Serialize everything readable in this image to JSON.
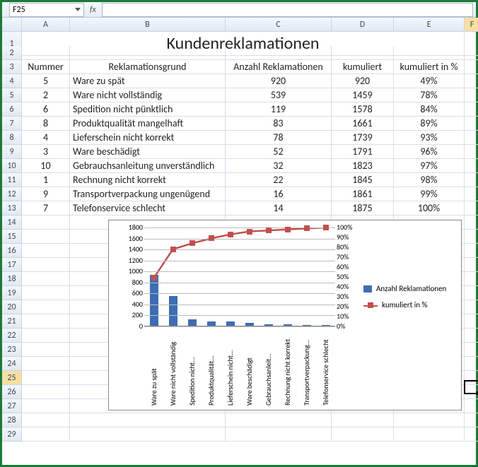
{
  "formula_bar": {
    "cell_ref": "F25",
    "fx_label": "fx",
    "formula": ""
  },
  "columns": [
    "A",
    "B",
    "C",
    "D",
    "E"
  ],
  "row_numbers": [
    1,
    2,
    3,
    4,
    5,
    6,
    7,
    8,
    9,
    10,
    11,
    12,
    13,
    14,
    15,
    16,
    17,
    18,
    19,
    20,
    21,
    22,
    23,
    24,
    25,
    26,
    27,
    28,
    29
  ],
  "title": "Kundenreklamationen",
  "headers": {
    "a": "Nummer",
    "b": "Reklamationsgrund",
    "c": "Anzahl Reklamationen",
    "d": "kumuliert",
    "e": "kumuliert in %"
  },
  "rows": [
    {
      "num": "5",
      "reason": "Ware zu spät",
      "count": "920",
      "cum": "920",
      "pct": "49%"
    },
    {
      "num": "2",
      "reason": "Ware nicht vollständig",
      "count": "539",
      "cum": "1459",
      "pct": "78%"
    },
    {
      "num": "6",
      "reason": "Spedition nicht pünktlich",
      "count": "119",
      "cum": "1578",
      "pct": "84%"
    },
    {
      "num": "8",
      "reason": "Produktqualität mangelhaft",
      "count": "83",
      "cum": "1661",
      "pct": "89%"
    },
    {
      "num": "4",
      "reason": "Lieferschein nicht korrekt",
      "count": "78",
      "cum": "1739",
      "pct": "93%"
    },
    {
      "num": "3",
      "reason": "Ware beschädigt",
      "count": "52",
      "cum": "1791",
      "pct": "96%"
    },
    {
      "num": "10",
      "reason": "Gebrauchsanleitung unverständlich",
      "count": "32",
      "cum": "1823",
      "pct": "97%"
    },
    {
      "num": "1",
      "reason": "Rechnung nicht korrekt",
      "count": "22",
      "cum": "1845",
      "pct": "98%"
    },
    {
      "num": "9",
      "reason": "Transportverpackung ungenügend",
      "count": "16",
      "cum": "1861",
      "pct": "99%"
    },
    {
      "num": "7",
      "reason": "Telefonservice schlecht",
      "count": "14",
      "cum": "1875",
      "pct": "100%"
    }
  ],
  "active_cell": "F25",
  "chart_data": {
    "type": "bar+line",
    "categories": [
      "Ware zu spät",
      "Ware nicht vollständig",
      "Spedition nicht...",
      "Produktqualität...",
      "Lieferschein nicht...",
      "Ware beschädigt",
      "Gebrauchsanleit...",
      "Rechnung nicht korrekt",
      "Transportverpackung...",
      "Telefonservice schlecht"
    ],
    "series": [
      {
        "name": "Anzahl Reklamationen",
        "axis": "left",
        "type": "bar",
        "values": [
          920,
          539,
          119,
          83,
          78,
          52,
          32,
          22,
          16,
          14
        ]
      },
      {
        "name": "kumuliert in %",
        "axis": "right",
        "type": "line",
        "values": [
          49,
          78,
          84,
          89,
          93,
          96,
          97,
          98,
          99,
          100
        ]
      }
    ],
    "y_left": {
      "min": 0,
      "max": 1800,
      "step": 200,
      "ticks": [
        "0",
        "200",
        "400",
        "600",
        "800",
        "1000",
        "1200",
        "1400",
        "1600",
        "1800"
      ]
    },
    "y_right": {
      "min": 0,
      "max": 100,
      "step": 10,
      "ticks": [
        "0%",
        "10%",
        "20%",
        "30%",
        "40%",
        "50%",
        "60%",
        "70%",
        "80%",
        "90%",
        "100%"
      ]
    },
    "legend": [
      "Anzahl Reklamationen",
      "kumuliert in %"
    ]
  }
}
